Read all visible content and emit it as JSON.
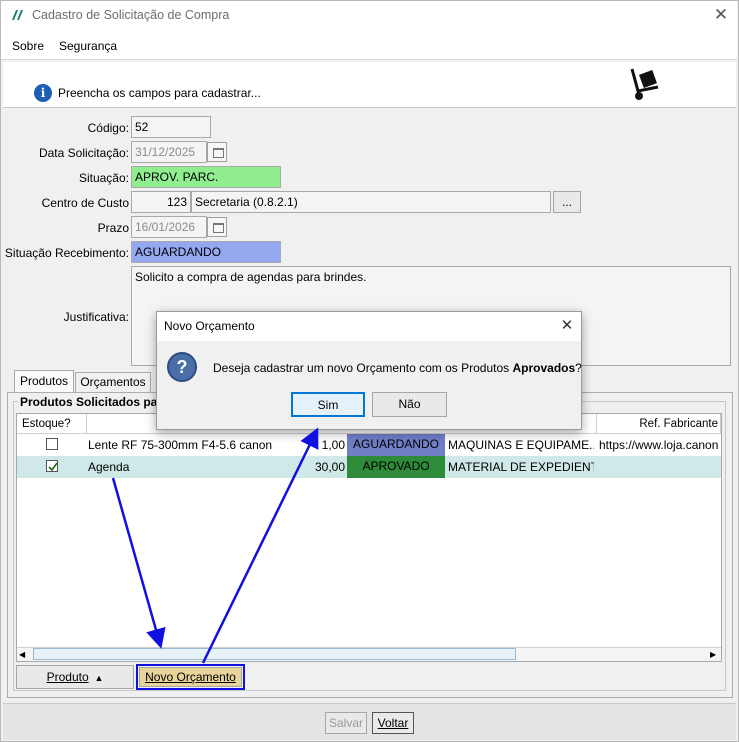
{
  "window": {
    "title": "Cadastro de Solicitação de Compra",
    "close_glyph": "✕"
  },
  "menu": {
    "items": [
      "Sobre",
      "Segurança"
    ]
  },
  "info": {
    "message": "Preencha os campos para cadastrar..."
  },
  "form": {
    "codigo_label": "Código:",
    "codigo_value": "52",
    "data_label": "Data Solicitação:",
    "data_value": "31/12/2025",
    "situacao_label": "Situação:",
    "situacao_value": "APROV. PARC.",
    "centro_label": "Centro de Custo",
    "centro_code": "123",
    "centro_desc": "Secretaria (0.8.2.1)",
    "centro_btn": "...",
    "prazo_label": "Prazo",
    "prazo_value": "16/01/2026",
    "receb_label": "Situação Recebimento:",
    "receb_value": "AGUARDANDO",
    "justificativa_label": "Justificativa:",
    "justificativa_value": "Solicito a compra de agendas para brindes."
  },
  "tabs": [
    "Produtos",
    "Orçamentos"
  ],
  "products": {
    "group_label": "Produtos Solicitados para",
    "headers": {
      "estoque": "Estoque?",
      "ref": "Ref. Fabricante"
    },
    "rows": [
      {
        "checked": false,
        "name": "Lente RF 75-300mm F4-5.6 canon",
        "qty": "1,00",
        "status": "AGUARDANDO",
        "group": "MAQUINAS E EQUIPAME...",
        "ref": "https://www.loja.canon"
      },
      {
        "checked": true,
        "name": "Agenda",
        "qty": "30,00",
        "status": "APROVADO",
        "group": "MATERIAL DE EXPEDIENTE",
        "ref": ""
      }
    ],
    "produto_button": "Produto",
    "novo_orcamento_button": "Novo Orçamento"
  },
  "footer": {
    "salvar": "Salvar",
    "voltar": "Voltar"
  },
  "dialog": {
    "title": "Novo Orçamento",
    "message_pre": "Deseja cadastrar um novo Orçamento com os Produtos ",
    "message_bold": "Aprovados",
    "message_post": "?",
    "yes": "Sim",
    "no": "Não"
  },
  "colors": {
    "situacao_bg": "#90ee90",
    "receb_bg": "#94a8f0",
    "status_aguardando": "#6f7fc8",
    "status_aprovado": "#2e8b3a",
    "row_selected": "#cfe8e8",
    "annotation": "#1010e0"
  }
}
